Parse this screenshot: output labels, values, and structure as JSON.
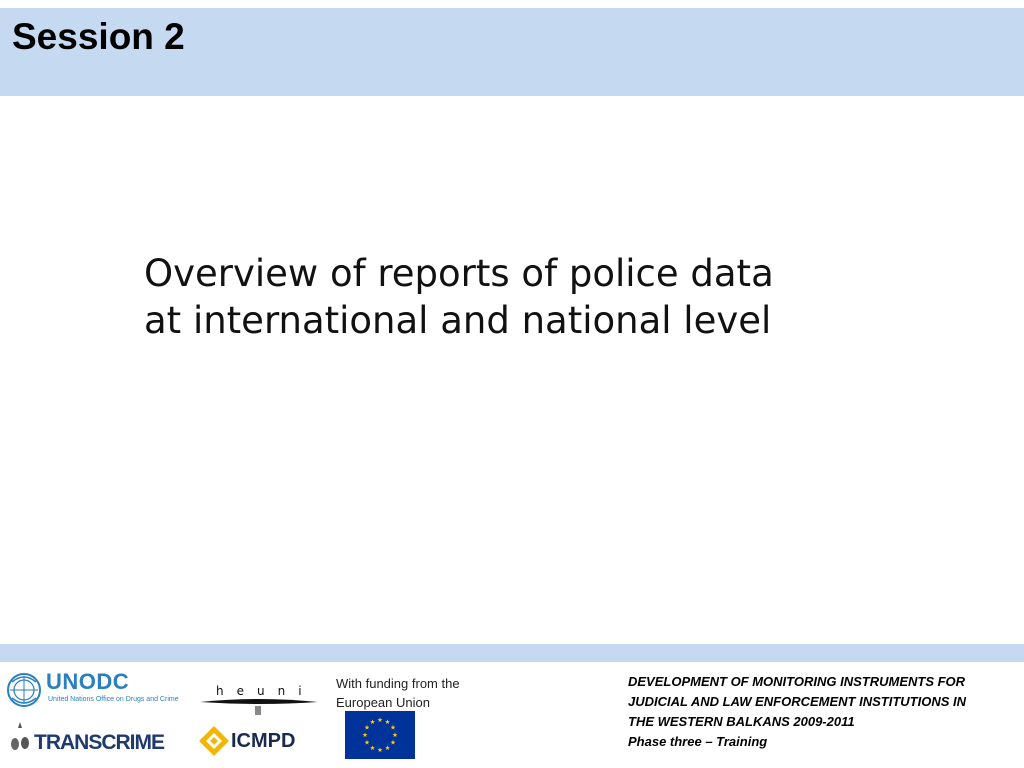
{
  "header": {
    "session_label": "Session 2"
  },
  "main": {
    "title_lines": [
      "Overview of reports of police data",
      "at international and national level"
    ]
  },
  "footer": {
    "logos": {
      "unodc": {
        "name": "UNODC",
        "subtitle": "United Nations Office on Drugs and Crime",
        "icon": "un-emblem-icon",
        "color": "#2a7fc1"
      },
      "heuni": {
        "name": "heuni",
        "icon": "heuni-logo-icon"
      },
      "transcrime": {
        "name": "TRANSCRIME",
        "icon": "transcrime-logo-icon",
        "color": "#1f3a6e"
      },
      "icmpd": {
        "name": "ICMPD",
        "icon": "icmpd-logo-icon",
        "color": "#f2b705"
      }
    },
    "funding_lines": [
      "With funding from the",
      "European Union"
    ],
    "eu_flag": {
      "icon": "eu-flag-icon",
      "background": "#003399",
      "stars": "#ffcc00"
    },
    "project_lines": [
      "DEVELOPMENT OF MONITORING INSTRUMENTS FOR",
      "JUDICIAL AND LAW ENFORCEMENT INSTITUTIONS IN",
      "THE WESTERN BALKANS 2009-2011",
      "Phase three – Training"
    ]
  },
  "colors": {
    "band": "#c5d9f1",
    "text": "#000000"
  }
}
